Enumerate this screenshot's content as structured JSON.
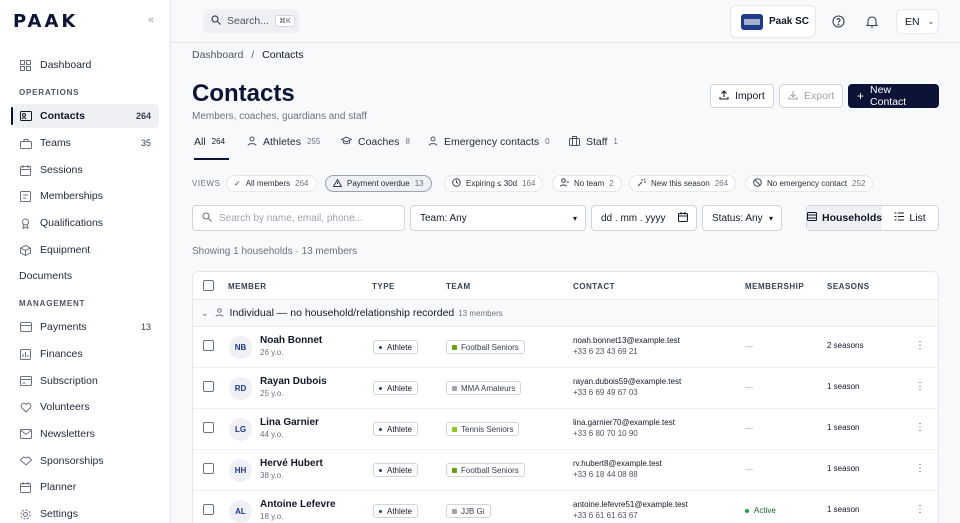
{
  "app": {
    "logo": "PAAK"
  },
  "sidebar": {
    "dashboard": "Dashboard",
    "operations_label": "OPERATIONS",
    "operations": [
      {
        "label": "Contacts",
        "count": "264",
        "icon": "contacts-icon"
      },
      {
        "label": "Teams",
        "count": "35",
        "icon": "teams-icon"
      },
      {
        "label": "Sessions",
        "count": "",
        "icon": "sessions-icon"
      },
      {
        "label": "Memberships",
        "count": "",
        "icon": "memberships-icon"
      },
      {
        "label": "Qualifications",
        "count": "",
        "icon": "qualifications-icon"
      },
      {
        "label": "Equipment",
        "count": "",
        "icon": "equipment-icon"
      }
    ],
    "documents": "Documents",
    "management_label": "MANAGEMENT",
    "management": [
      {
        "label": "Payments",
        "count": "13",
        "icon": "payments-icon"
      },
      {
        "label": "Finances",
        "count": "",
        "icon": "finances-icon"
      },
      {
        "label": "Subscription",
        "count": "",
        "icon": "subscription-icon"
      },
      {
        "label": "Volunteers",
        "count": "",
        "icon": "volunteers-icon"
      },
      {
        "label": "Newsletters",
        "count": "",
        "icon": "newsletters-icon"
      },
      {
        "label": "Sponsorships",
        "count": "",
        "icon": "sponsorships-icon"
      },
      {
        "label": "Planner",
        "count": "",
        "icon": "planner-icon"
      },
      {
        "label": "Settings",
        "count": "",
        "icon": "settings-icon"
      }
    ]
  },
  "topbar": {
    "search_placeholder": "Search...",
    "search_shortcut": "⌘K",
    "club_name": "Paak SC",
    "language": "EN"
  },
  "breadcrumb": {
    "root": "Dashboard",
    "sep": "/",
    "current": "Contacts"
  },
  "page": {
    "title": "Contacts",
    "subtitle": "Members, coaches, guardians and staff",
    "import": "Import",
    "export": "Export",
    "new_contact": "New Contact"
  },
  "tabs": [
    {
      "label": "All",
      "count": "264"
    },
    {
      "label": "Athletes",
      "count": "255"
    },
    {
      "label": "Coaches",
      "count": "8"
    },
    {
      "label": "Emergency contacts",
      "count": "0"
    },
    {
      "label": "Staff",
      "count": "1"
    }
  ],
  "views": {
    "label": "VIEWS",
    "chips": [
      {
        "label": "All members",
        "count": "264"
      },
      {
        "label": "Payment overdue",
        "count": "13"
      },
      {
        "label": "Expiring ≤ 30d",
        "count": "164"
      },
      {
        "label": "No team",
        "count": "2"
      },
      {
        "label": "New this season",
        "count": "264"
      },
      {
        "label": "No emergency contact",
        "count": "252"
      }
    ]
  },
  "filters": {
    "search_placeholder": "Search by name, email, phone...",
    "team": "Team: Any",
    "date": "dd . mm . yyyy",
    "status": "Status: Any",
    "households": "Households",
    "list": "List"
  },
  "showing": "Showing 1 households · 13 members",
  "table": {
    "headers": {
      "member": "MEMBER",
      "type": "TYPE",
      "team": "TEAM",
      "contact": "CONTACT",
      "membership": "MEMBERSHIP",
      "seasons": "SEASONS"
    },
    "group": {
      "label": "Individual — no household/relationship recorded",
      "count": "13 members"
    },
    "rows": [
      {
        "initials": "NB",
        "name": "Noah Bonnet",
        "age": "26 y.o.",
        "type": "Athlete",
        "team": "Football Seniors",
        "team_color": "#65a30d",
        "email": "noah.bonnet13@example.test",
        "phone": "+33 6 23 43 69 21",
        "membership": "—",
        "seasons": "2 seasons"
      },
      {
        "initials": "RD",
        "name": "Rayan Dubois",
        "age": "25 y.o.",
        "type": "Athlete",
        "team": "MMA Amateurs",
        "team_color": "#9ca3af",
        "email": "rayan.dubois59@example.test",
        "phone": "+33 6 69 49 67 03",
        "membership": "—",
        "seasons": "1 season"
      },
      {
        "initials": "LG",
        "name": "Lina Garnier",
        "age": "44 y.o.",
        "type": "Athlete",
        "team": "Tennis Seniors",
        "team_color": "#84cc16",
        "email": "lina.garnier70@example.test",
        "phone": "+33 6 80 70 10 90",
        "membership": "—",
        "seasons": "1 season"
      },
      {
        "initials": "HH",
        "name": "Hervé Hubert",
        "age": "38 y.o.",
        "type": "Athlete",
        "team": "Football Seniors",
        "team_color": "#65a30d",
        "email": "rv.hubert8@example.test",
        "phone": "+33 6 18 44 08 88",
        "membership": "—",
        "seasons": "1 season"
      },
      {
        "initials": "AL",
        "name": "Antoine Lefevre",
        "age": "18 y.o.",
        "type": "Athlete",
        "team": "JJB Gi",
        "team_color": "#9ca3af",
        "email": "antoine.lefevre51@example.test",
        "phone": "+33 6 61 61 63 67",
        "membership": "Active",
        "seasons": "1 season"
      }
    ]
  }
}
